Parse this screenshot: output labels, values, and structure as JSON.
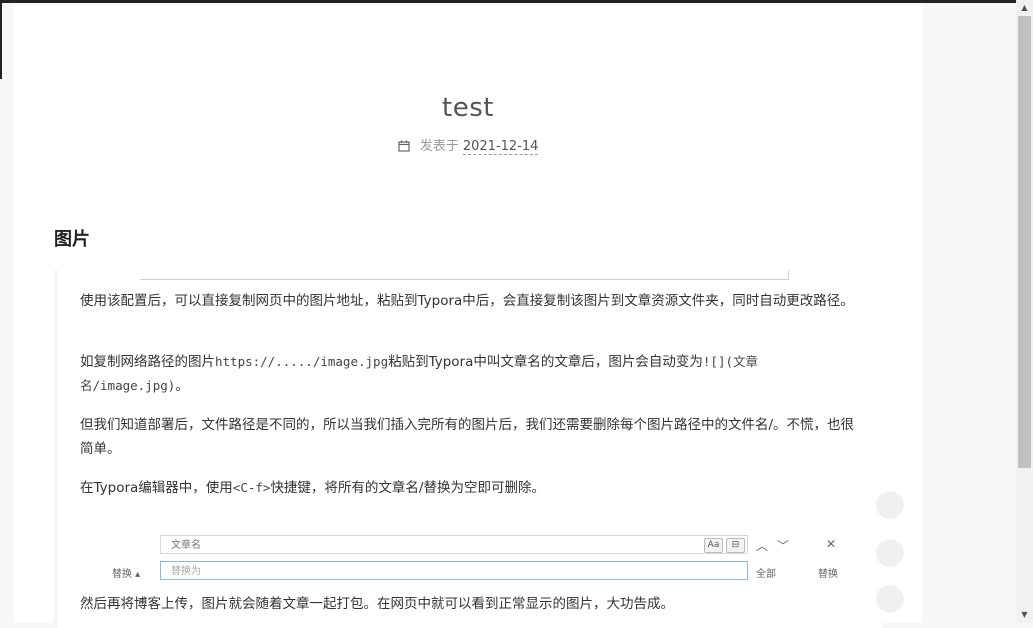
{
  "post": {
    "title": "test",
    "meta_label": "发表于",
    "date": "2021-12-14"
  },
  "section": {
    "heading": "图片"
  },
  "screenshot": {
    "para1": "使用该配置后，可以直接复制网页中的图片地址，粘贴到Typora中后，会直接复制该图片到文章资源文件夹，同时自动更改路径。",
    "para2_prefix": "如复制网络路径的图片",
    "para2_code1": "https://...../image.jpg",
    "para2_mid": "粘贴到Typora中叫文章名的文章后，图片会自动变为",
    "para2_code2": "![](文章名/image.jpg)",
    "para2_suffix": "。",
    "para3": "但我们知道部署后，文件路径是不同的，所以当我们插入完所有的图片后，我们还需要删除每个图片路径中的文件名/。不慌，也很简单。",
    "para4_prefix": "在Typora编辑器中，使用",
    "para4_code": "<C-f>",
    "para4_suffix": "快捷键，将所有的文章名/替换为空即可删除。",
    "para5": "然后再将博客上传，图片就会随着文章一起打包。在网页中就可以看到正常显示的图片，大功告成。",
    "findbar": {
      "find_value": "文章名",
      "replace_placeholder": "替换为",
      "replace_toggle": "替换 ▴",
      "match_case": "Aa",
      "whole_word": "⊟",
      "prev": "︿",
      "next": "﹀",
      "close": "✕",
      "replace_all": "全部",
      "replace_one": "替换"
    }
  },
  "colors": {
    "top_bar": "#222222",
    "background": "#f5f7f9",
    "card": "#ffffff"
  }
}
